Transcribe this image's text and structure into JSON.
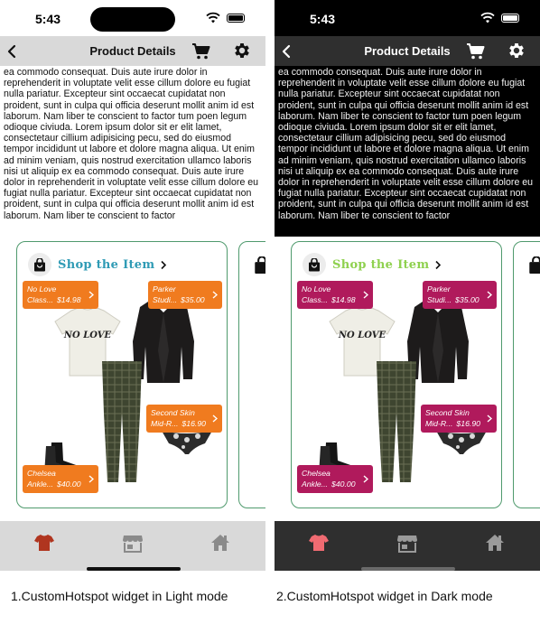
{
  "status": {
    "time": "5:43"
  },
  "header": {
    "title": "Product Details"
  },
  "body_text": "ea commodo consequat. Duis aute irure dolor in reprehenderit in voluptate velit esse cillum dolore eu fugiat nulla pariatur. Excepteur sint occaecat cupidatat non proident, sunt in culpa qui officia deserunt mollit anim id est laborum. Nam liber te conscient to factor tum poen legum odioque civiuda. Lorem ipsum dolor sit er elit lamet, consectetaur cillium adipisicing pecu, sed do eiusmod tempor incididunt ut labore et dolore magna aliqua. Ut enim ad minim veniam, quis nostrud exercitation ullamco laboris nisi ut aliquip ex ea commodo consequat. Duis aute irure dolor in reprehenderit in voluptate velit esse cillum dolore eu fugiat nulla pariatur. Excepteur sint occaecat cupidatat non proident, sunt in culpa qui officia deserunt mollit anim id est laborum. Nam liber te conscient to factor",
  "widget": {
    "title": "Shop the Item",
    "tshirt_print": "NO LOVE",
    "hotspots": [
      {
        "line1": "No Love",
        "line2": "Class...",
        "price": "$14.98"
      },
      {
        "line1": "Parker",
        "line2": "Studi...",
        "price": "$35.00"
      },
      {
        "line1": "Second Skin",
        "line2": "Mid-R...",
        "price": "$16.90"
      },
      {
        "line1": "Chelsea",
        "line2": "Ankle...",
        "price": "$40.00"
      }
    ]
  },
  "tabs": [
    {
      "icon": "shirt-icon",
      "active": true
    },
    {
      "icon": "store-icon",
      "active": false
    },
    {
      "icon": "home-icon",
      "active": false
    }
  ],
  "modes": {
    "light": {
      "caption": "1.CustomHotspot widget in Light mode",
      "accent": "#f07b1f",
      "title_color": "#2f9bb5",
      "active_tab": "#b0351f"
    },
    "dark": {
      "caption": "2.CustomHotspot widget in Dark mode",
      "accent": "#b01a5c",
      "title_color": "#8fd14f",
      "active_tab": "#f06b72"
    }
  },
  "colors": {
    "card_border": "#4f9a6d"
  }
}
